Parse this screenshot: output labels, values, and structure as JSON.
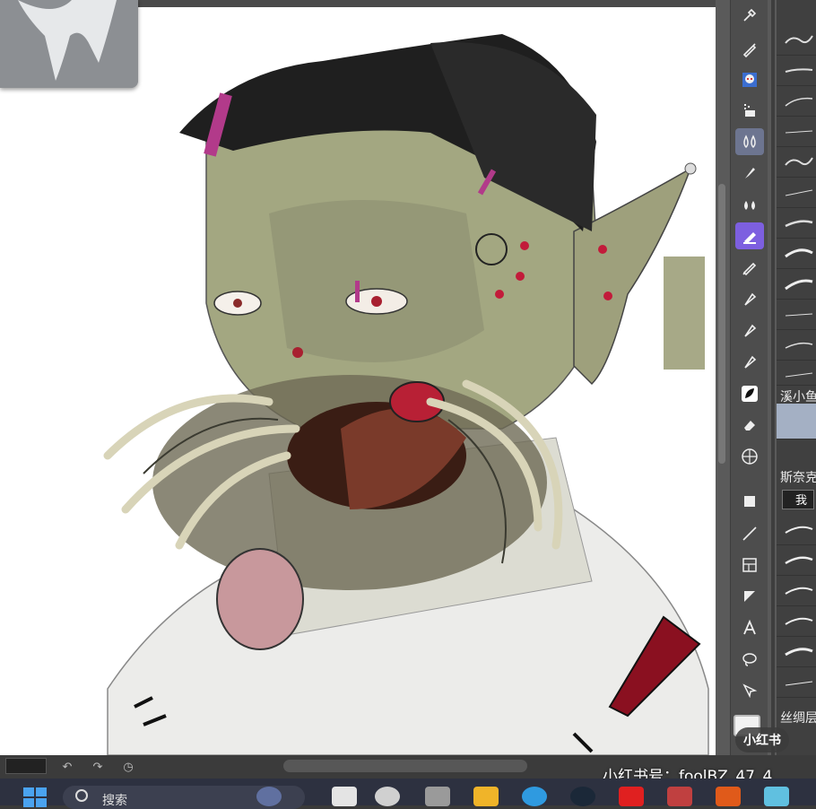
{
  "brush_panel": {
    "labels": [
      "溪小鱼",
      "斯奈克",
      "丝绸层"
    ],
    "brush_button_label": "我"
  },
  "taskbar": {
    "search_label": "搜索"
  },
  "watermark": {
    "account": "小红书号：foolBZ_47_4",
    "badge": "小红书"
  },
  "colors": {
    "accent": "#7d5fe0",
    "canvas_bg": "#ffffff",
    "ui_bg": "#4d4d4d",
    "skin_green": "#9da07a"
  },
  "tools": [
    "eyedropper-icon",
    "pen-icon",
    "avatar-icon",
    "fill-icon",
    "blur-icon",
    "brush-icon",
    "smudge-icon",
    "marker-icon",
    "pencil-icon",
    "ink-pen-icon",
    "calligraphy-icon",
    "felt-pen-icon",
    "leaf-brush-icon",
    "eraser-icon",
    "grid-icon",
    "square-icon",
    "line-icon",
    "frame-icon",
    "triangle-icon",
    "text-icon",
    "lasso-icon",
    "transform-icon"
  ]
}
